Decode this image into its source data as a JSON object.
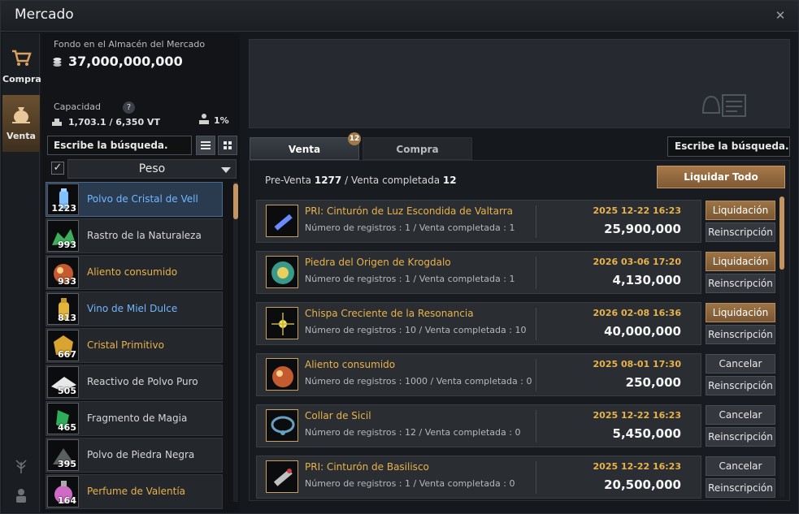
{
  "window": {
    "title": "Mercado",
    "close_icon": "close-icon"
  },
  "vnav": [
    {
      "label": "Compra",
      "icon": "cart-icon",
      "active": false
    },
    {
      "label": "Venta",
      "icon": "moneybag-icon",
      "active": true
    }
  ],
  "inventory": {
    "fund_label": "Fondo en el Almacén del Mercado",
    "fund_value": "37,000,000,000",
    "capacity_label": "Capacidad",
    "capacity_value": "1,703.1 / 6,350 VT",
    "capacity_pct": "1%",
    "search_placeholder": "Escribe la búsqueda.",
    "sort_label": "Peso",
    "items": [
      {
        "name": "Polvo de Cristal de Vell",
        "qty": "1223",
        "color": "#6fb7ff",
        "selected": true
      },
      {
        "name": "Rastro de la Naturaleza",
        "qty": "993",
        "color": "#d6d6d6",
        "selected": false
      },
      {
        "name": "Aliento consumido",
        "qty": "933",
        "color": "#e9b24a",
        "selected": false
      },
      {
        "name": "Vino de Miel Dulce",
        "qty": "813",
        "color": "#6fb7ff",
        "selected": false
      },
      {
        "name": "Cristal Primitivo",
        "qty": "667",
        "color": "#e9b24a",
        "selected": false
      },
      {
        "name": "Reactivo de Polvo Puro",
        "qty": "505",
        "color": "#d6d6d6",
        "selected": false
      },
      {
        "name": "Fragmento de Magia",
        "qty": "465",
        "color": "#d6d6d6",
        "selected": false
      },
      {
        "name": "Polvo de Piedra Negra",
        "qty": "395",
        "color": "#d6d6d6",
        "selected": false
      },
      {
        "name": "Perfume de Valentía",
        "qty": "164",
        "color": "#e9b24a",
        "selected": false
      }
    ]
  },
  "tabs": [
    {
      "label": "Venta",
      "active": true,
      "badge": "12"
    },
    {
      "label": "Compra",
      "active": false
    }
  ],
  "search2_placeholder": "Escribe la búsqueda.",
  "summary": {
    "pre_label": "Pre-Venta",
    "pre_value": "1277",
    "done_label": "Venta completada",
    "done_value": "12"
  },
  "liquidar_all": "Liquidar Todo",
  "listings": [
    {
      "name": "PRI: Cinturón de Luz Escondida de Valtarra",
      "meta": "Número de registros : 1 / Venta completada : 1",
      "date": "2025 12-22 16:23",
      "price": "25,900,000",
      "btn1": "Liquidación",
      "btn1_style": "gold",
      "btn2": "Reinscripción"
    },
    {
      "name": "Piedra del Origen de Krogdalo",
      "meta": "Número de registros : 1 / Venta completada : 1",
      "date": "2026 03-06 17:20",
      "price": "4,130,000",
      "btn1": "Liquidación",
      "btn1_style": "gold",
      "btn2": "Reinscripción"
    },
    {
      "name": "Chispa Creciente de la Resonancia",
      "meta": "Número de registros : 10 / Venta completada : 10",
      "date": "2026 02-08 16:36",
      "price": "40,000,000",
      "btn1": "Liquidación",
      "btn1_style": "gold",
      "btn2": "Reinscripción"
    },
    {
      "name": "Aliento consumido",
      "meta": "Número de registros : 1000 / Venta completada : 0",
      "date": "2025 08-01 17:30",
      "price": "250,000",
      "btn1": "Cancelar",
      "btn1_style": "gray",
      "btn2": "Reinscripción"
    },
    {
      "name": "Collar de Sicil",
      "meta": "Número de registros : 12 / Venta completada : 0",
      "date": "2025 12-22 16:23",
      "price": "5,450,000",
      "btn1": "Cancelar",
      "btn1_style": "gray",
      "btn2": "Reinscripción"
    },
    {
      "name": "PRI: Cinturón de Basilisco",
      "meta": "Número de registros : 1 / Venta completada : 0",
      "date": "2025 12-22 16:23",
      "price": "20,500,000",
      "btn1": "Cancelar",
      "btn1_style": "gray",
      "btn2": "Reinscripción"
    }
  ]
}
